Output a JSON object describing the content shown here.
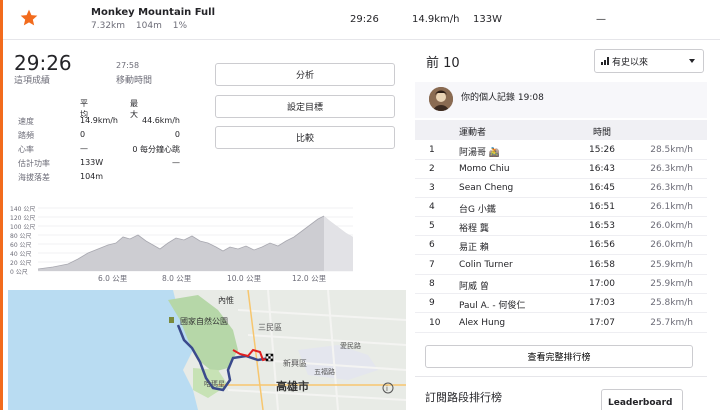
{
  "segment": {
    "name": "Monkey Mountain Full",
    "distance": "7.32km",
    "elevation": "104m",
    "grade": "1%",
    "time": "29:26",
    "speed": "14.9km/h",
    "power": "133W",
    "extra": "—"
  },
  "effort": {
    "time": "29:26",
    "time_label": "這項成績",
    "moving_time": "27:58",
    "moving_label": "移動時間"
  },
  "buttons": {
    "analyze": "分析",
    "set_goal": "設定目標",
    "compare": "比較",
    "view_full": "查看完整排行榜"
  },
  "stats": {
    "head_avg": "平均",
    "head_max": "最大",
    "rows": [
      {
        "label": "速度",
        "avg": "14.9km/h",
        "max": "44.6km/h"
      },
      {
        "label": "踏頻",
        "avg": "0",
        "max": "0"
      },
      {
        "label": "心率",
        "avg": "—",
        "max": "0 每分鐘心跳"
      },
      {
        "label": "估計功率",
        "avg": "133W",
        "max": "—"
      },
      {
        "label": "海拔落差",
        "avg": "104m",
        "max": ""
      }
    ]
  },
  "elevation_chart": {
    "y_ticks": [
      "140 公尺",
      "120 公尺",
      "100 公尺",
      "80 公尺",
      "60 公尺",
      "40 公尺",
      "20 公尺",
      "0 公尺"
    ],
    "x_ticks": [
      "6.0 公里",
      "8.0 公里",
      "10.0 公里",
      "12.0 公里"
    ]
  },
  "map": {
    "labels": [
      "內惟",
      "國家自然公園",
      "三民區",
      "愛民路",
      "新興區",
      "高雄市",
      "五福路",
      "哈瑪星"
    ]
  },
  "leaderboard": {
    "title": "前 10",
    "filter": "有史以來",
    "pr_text": "你的個人記錄 19:08",
    "col_athlete": "運動者",
    "col_time": "時間",
    "rows": [
      {
        "rank": "1",
        "name": "阿湯哥 🚵",
        "time": "15:26",
        "speed": "28.5km/h"
      },
      {
        "rank": "2",
        "name": "Momo Chiu",
        "time": "16:43",
        "speed": "26.3km/h"
      },
      {
        "rank": "3",
        "name": "Sean Cheng",
        "time": "16:45",
        "speed": "26.3km/h"
      },
      {
        "rank": "4",
        "name": "台G 小鐵",
        "time": "16:51",
        "speed": "26.1km/h"
      },
      {
        "rank": "5",
        "name": "裕程 龔",
        "time": "16:53",
        "speed": "26.0km/h"
      },
      {
        "rank": "6",
        "name": "易正 賴",
        "time": "16:56",
        "speed": "26.0km/h"
      },
      {
        "rank": "7",
        "name": "Colin Turner",
        "time": "16:58",
        "speed": "25.9km/h"
      },
      {
        "rank": "8",
        "name": "阿威 曾",
        "time": "17:00",
        "speed": "25.9km/h"
      },
      {
        "rank": "9",
        "name": "Paul A. - 何俊仁",
        "time": "17:03",
        "speed": "25.8km/h"
      },
      {
        "rank": "10",
        "name": "Alex Hung",
        "time": "17:07",
        "speed": "25.7km/h"
      }
    ]
  },
  "subscribe": {
    "title": "訂閱路段排行榜",
    "badge": "Leaderboard"
  },
  "colors": {
    "accent": "#f26b1d",
    "route_blue": "#3a4a8c",
    "route_red": "#e02020"
  }
}
